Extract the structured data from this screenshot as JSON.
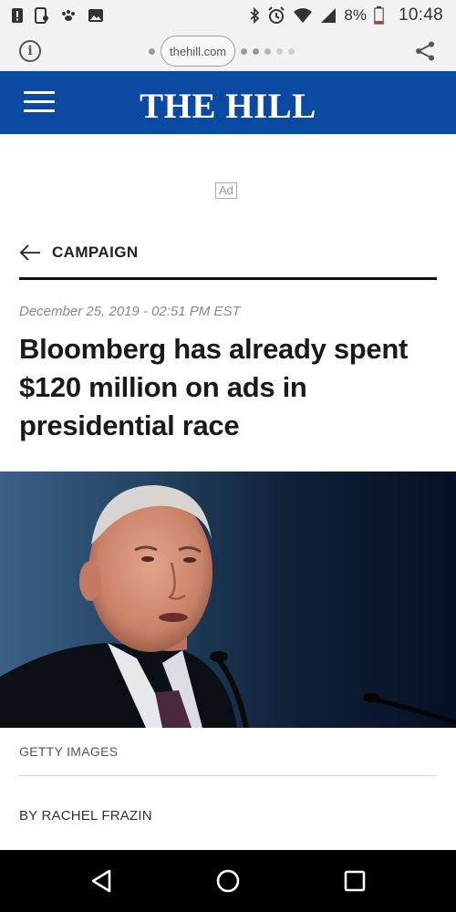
{
  "status_bar": {
    "battery_percent": "8%",
    "time": "10:48",
    "icons": [
      "alert-icon",
      "tablet-icon",
      "paw-icon",
      "image-icon",
      "bluetooth-icon",
      "alarm-icon",
      "wifi-icon",
      "signal-icon",
      "battery-icon"
    ]
  },
  "browser": {
    "url": "thehill.com",
    "info_icon": "info-icon",
    "share_icon": "share-icon"
  },
  "site": {
    "logo": "THE HILL",
    "menu_icon": "hamburger-menu-icon",
    "brand_color": "#0b4aa2"
  },
  "ad": {
    "label": "Ad"
  },
  "article": {
    "section": "CAMPAIGN",
    "date": "December 25, 2019 - 02:51 PM EST",
    "headline": "Bloomberg has already spent $120 million on ads in presidential race",
    "photo_credit": "GETTY IMAGES",
    "byline": "BY RACHEL FRAZIN"
  },
  "nav": {
    "icons": [
      "back-triangle-icon",
      "home-circle-icon",
      "recents-square-icon"
    ]
  }
}
